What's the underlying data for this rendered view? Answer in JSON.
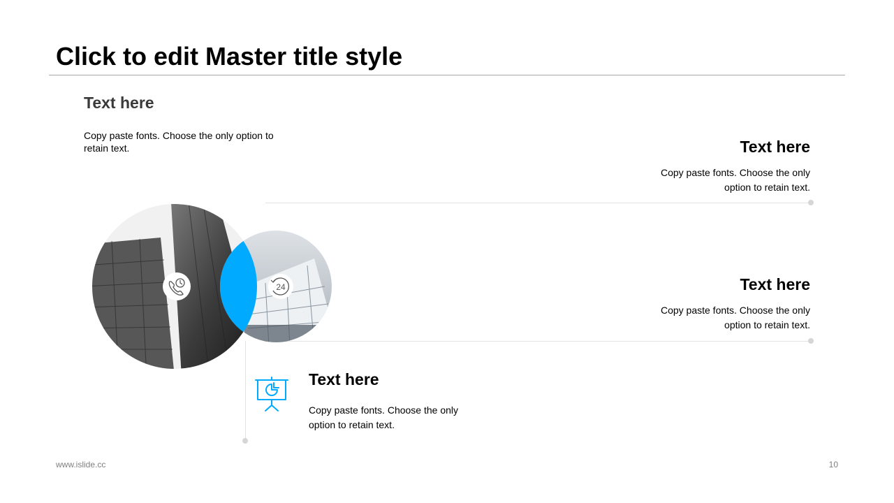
{
  "slide": {
    "title": "Click to edit Master title style",
    "page_number": "10",
    "footer": "www.islide.cc"
  },
  "blocks": [
    {
      "heading": "Text here",
      "body": "Copy paste fonts. Choose the only option to retain text."
    },
    {
      "heading": "Text here",
      "body": "Copy paste fonts. Choose the only option to retain text."
    },
    {
      "heading": "Text here",
      "body": "Copy paste fonts. Choose the only option to retain text."
    },
    {
      "heading": "Text here",
      "body": "Copy paste fonts. Choose the only option to retain text."
    }
  ],
  "colors": {
    "accent": "#00AAFF",
    "rule": "#A6A6A6",
    "line": "#E3E3E3"
  },
  "icons": [
    "phone-clock-icon",
    "24-hour-icon",
    "presentation-chart-icon"
  ]
}
